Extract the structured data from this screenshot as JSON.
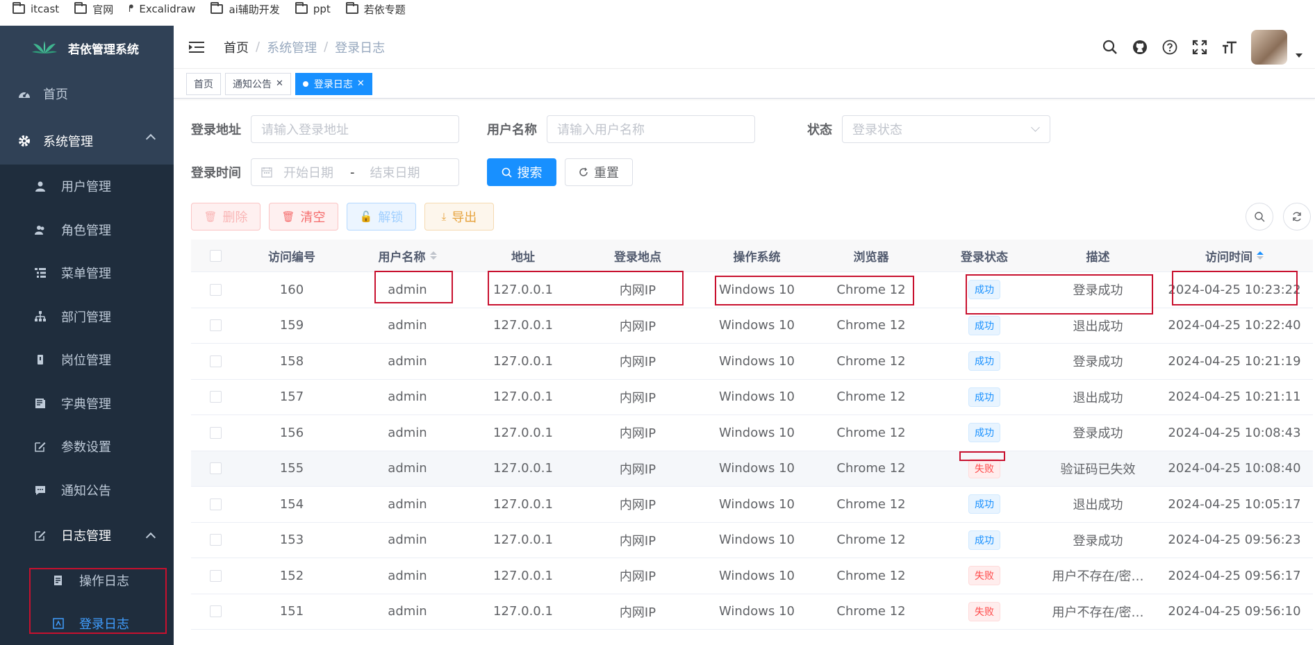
{
  "bookmarks": [
    "itcast",
    "官网",
    "Excalidraw",
    "ai辅助开发",
    "ppt",
    "若依专题"
  ],
  "app": {
    "title": "若依管理系统"
  },
  "sidebar": {
    "home": "首页",
    "system": "系统管理",
    "system_items": [
      "用户管理",
      "角色管理",
      "菜单管理",
      "部门管理",
      "岗位管理",
      "字典管理",
      "参数设置",
      "通知公告"
    ],
    "log": "日志管理",
    "log_items": [
      "操作日志",
      "登录日志"
    ]
  },
  "breadcrumb": [
    "首页",
    "系统管理",
    "登录日志"
  ],
  "tags": [
    {
      "label": "首页",
      "closable": false,
      "active": false
    },
    {
      "label": "通知公告",
      "closable": true,
      "active": false
    },
    {
      "label": "登录日志",
      "closable": true,
      "active": true
    }
  ],
  "search": {
    "ipaddr_label": "登录地址",
    "ipaddr_placeholder": "请输入登录地址",
    "username_label": "用户名称",
    "username_placeholder": "请输入用户名称",
    "status_label": "状态",
    "status_placeholder": "登录状态",
    "time_label": "登录时间",
    "start_placeholder": "开始日期",
    "range_sep": "-",
    "end_placeholder": "结束日期",
    "search_btn": "搜索",
    "reset_btn": "重置"
  },
  "toolbar": {
    "delete": "删除",
    "clear": "清空",
    "unlock": "解锁",
    "export": "导出"
  },
  "table": {
    "headers": [
      "访问编号",
      "用户名称",
      "地址",
      "登录地点",
      "操作系统",
      "浏览器",
      "登录状态",
      "描述",
      "访问时间"
    ],
    "rows": [
      {
        "id": "160",
        "user": "admin",
        "ip": "127.0.0.1",
        "loc": "内网IP",
        "os": "Windows 10",
        "browser": "Chrome 12",
        "status": "成功",
        "ok": true,
        "msg": "登录成功",
        "time": "2024-04-25 10:23:22"
      },
      {
        "id": "159",
        "user": "admin",
        "ip": "127.0.0.1",
        "loc": "内网IP",
        "os": "Windows 10",
        "browser": "Chrome 12",
        "status": "成功",
        "ok": true,
        "msg": "退出成功",
        "time": "2024-04-25 10:22:40"
      },
      {
        "id": "158",
        "user": "admin",
        "ip": "127.0.0.1",
        "loc": "内网IP",
        "os": "Windows 10",
        "browser": "Chrome 12",
        "status": "成功",
        "ok": true,
        "msg": "登录成功",
        "time": "2024-04-25 10:21:19"
      },
      {
        "id": "157",
        "user": "admin",
        "ip": "127.0.0.1",
        "loc": "内网IP",
        "os": "Windows 10",
        "browser": "Chrome 12",
        "status": "成功",
        "ok": true,
        "msg": "退出成功",
        "time": "2024-04-25 10:21:11"
      },
      {
        "id": "156",
        "user": "admin",
        "ip": "127.0.0.1",
        "loc": "内网IP",
        "os": "Windows 10",
        "browser": "Chrome 12",
        "status": "成功",
        "ok": true,
        "msg": "登录成功",
        "time": "2024-04-25 10:08:43"
      },
      {
        "id": "155",
        "user": "admin",
        "ip": "127.0.0.1",
        "loc": "内网IP",
        "os": "Windows 10",
        "browser": "Chrome 12",
        "status": "失败",
        "ok": false,
        "msg": "验证码已失效",
        "time": "2024-04-25 10:08:40"
      },
      {
        "id": "154",
        "user": "admin",
        "ip": "127.0.0.1",
        "loc": "内网IP",
        "os": "Windows 10",
        "browser": "Chrome 12",
        "status": "成功",
        "ok": true,
        "msg": "退出成功",
        "time": "2024-04-25 10:05:17"
      },
      {
        "id": "153",
        "user": "admin",
        "ip": "127.0.0.1",
        "loc": "内网IP",
        "os": "Windows 10",
        "browser": "Chrome 12",
        "status": "成功",
        "ok": true,
        "msg": "登录成功",
        "time": "2024-04-25 09:56:23"
      },
      {
        "id": "152",
        "user": "admin",
        "ip": "127.0.0.1",
        "loc": "内网IP",
        "os": "Windows 10",
        "browser": "Chrome 12",
        "status": "失败",
        "ok": false,
        "msg": "用户不存在/密…",
        "time": "2024-04-25 09:56:17"
      },
      {
        "id": "151",
        "user": "admin",
        "ip": "127.0.0.1",
        "loc": "内网IP",
        "os": "Windows 10",
        "browser": "Chrome 12",
        "status": "失败",
        "ok": false,
        "msg": "用户不存在/密…",
        "time": "2024-04-25 09:56:10"
      }
    ]
  },
  "colors": {
    "sidebar_bg": "#304156",
    "primary": "#1890ff",
    "annotation": "#c8102e"
  }
}
